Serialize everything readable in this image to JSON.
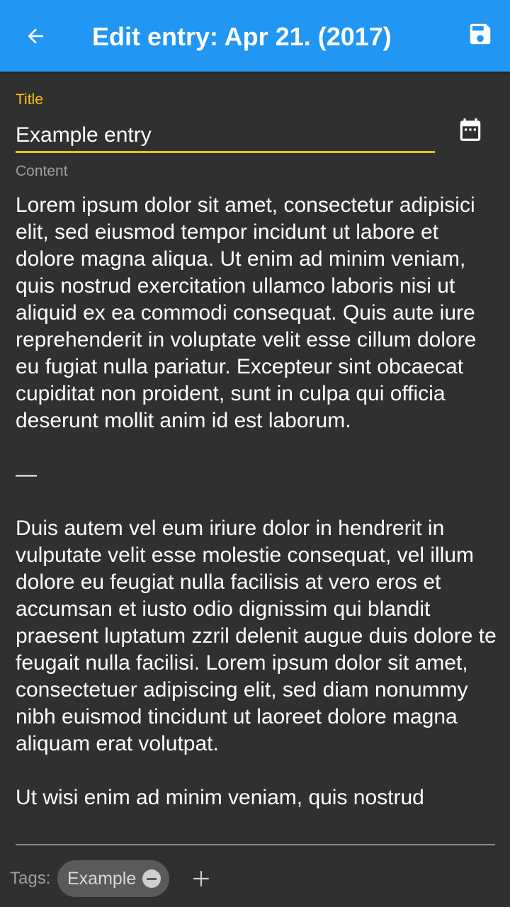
{
  "appbar": {
    "title": "Edit entry: Apr 21. (2017)",
    "back_icon": "arrow-back-icon",
    "save_icon": "save-icon",
    "background": "#2196F3"
  },
  "form": {
    "title_label": "Title",
    "title_value": "Example entry",
    "calendar_icon": "calendar-icon",
    "content_label": "Content",
    "content_value": "Lorem ipsum dolor sit amet, consectetur adipisici elit, sed eiusmod tempor incidunt ut labore et dolore magna aliqua. Ut enim ad minim veniam, quis nostrud exercitation ullamco laboris nisi ut aliquid ex ea commodi consequat. Quis aute iure reprehenderit in voluptate velit esse cillum dolore eu fugiat nulla pariatur. Excepteur sint obcaecat cupiditat non proident, sunt in culpa qui officia deserunt mollit anim id est laborum.\n\n—\n\nDuis autem vel eum iriure dolor in hendrerit in vulputate velit esse molestie consequat, vel illum dolore eu feugiat nulla facilisis at vero eros et accumsan et iusto odio dignissim qui blandit praesent luptatum zzril delenit augue duis dolore te feugait nulla facilisi. Lorem ipsum dolor sit amet, consectetuer adipiscing elit, sed diam nonummy nibh euismod tincidunt ut laoreet dolore magna aliquam erat volutpat.\n\nUt wisi enim ad minim veniam, quis nostrud",
    "accent": "#FFC107"
  },
  "tags": {
    "label": "Tags:",
    "items": [
      {
        "label": "Example",
        "remove_icon": "remove-circle-icon"
      }
    ],
    "add_icon": "plus-icon"
  }
}
